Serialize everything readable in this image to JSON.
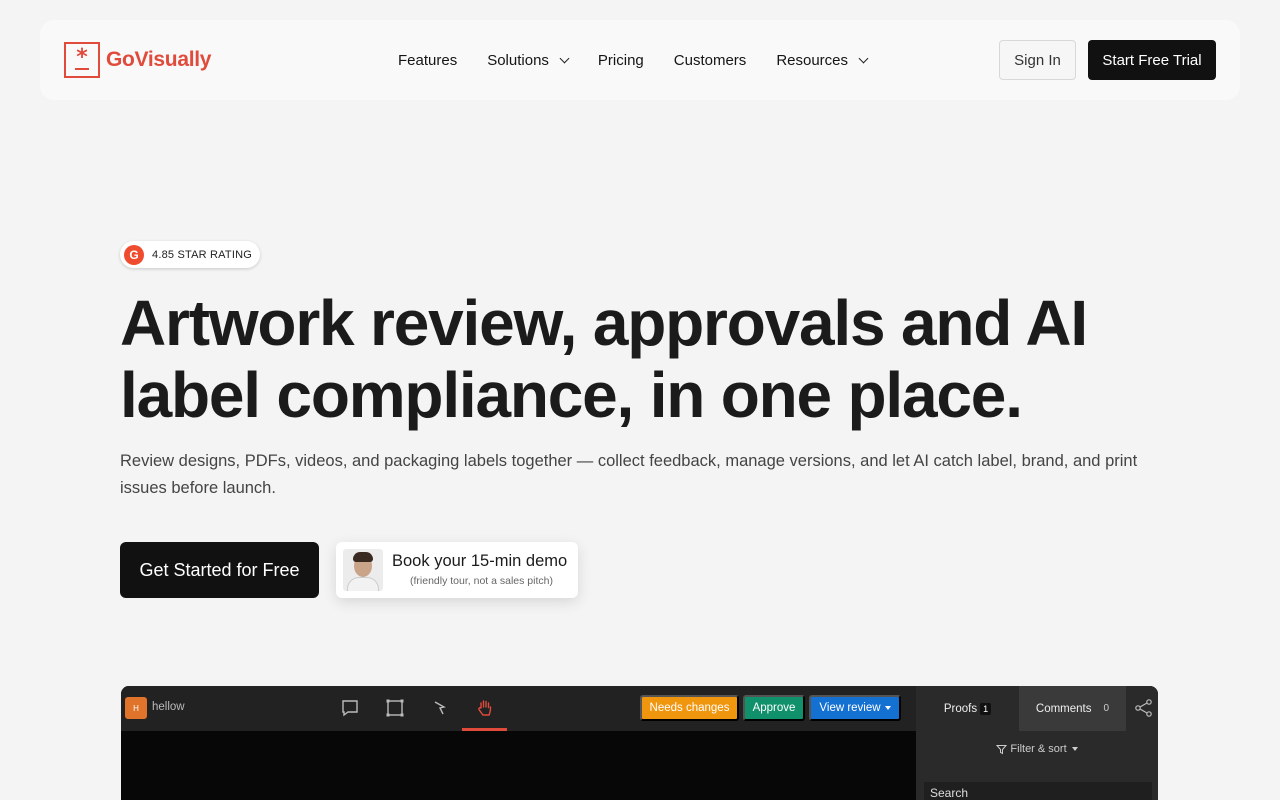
{
  "brand": {
    "name": "GoVisually",
    "accent": "#e04b3c"
  },
  "nav": {
    "items": [
      {
        "label": "Features",
        "dropdown": false
      },
      {
        "label": "Solutions",
        "dropdown": true
      },
      {
        "label": "Pricing",
        "dropdown": false
      },
      {
        "label": "Customers",
        "dropdown": false
      },
      {
        "label": "Resources",
        "dropdown": true
      }
    ],
    "sign_in": "Sign In",
    "start_trial": "Start Free Trial"
  },
  "hero": {
    "badge": "4.85 STAR RATING",
    "badge_logo": "G",
    "headline_1": "Artwork review, approvals and AI",
    "headline_2": "label compliance, in one place.",
    "subtitle": "Review designs, PDFs, videos, and packaging labels together — collect feedback, manage versions, and let AI catch label, brand, and print issues before launch.",
    "cta_primary": "Get Started for Free",
    "demo_title": "Book your 15-min demo",
    "demo_subtitle": "(friendly tour, not a sales pitch)"
  },
  "app_preview": {
    "file_initial": "H",
    "file_name": "hellow",
    "tools": [
      "comment-icon",
      "rectangle-icon",
      "pointer-icon",
      "hand-icon"
    ],
    "needs_changes": "Needs changes",
    "approve": "Approve",
    "view_review": "View review",
    "tab_proofs": "Proofs",
    "proofs_count": "1",
    "tab_comments": "Comments",
    "comments_count": "0",
    "filter_sort": "Filter & sort",
    "search": "Search",
    "colors": {
      "needs": "#f0950e",
      "approve": "#10916b",
      "view": "#1470d1"
    }
  }
}
